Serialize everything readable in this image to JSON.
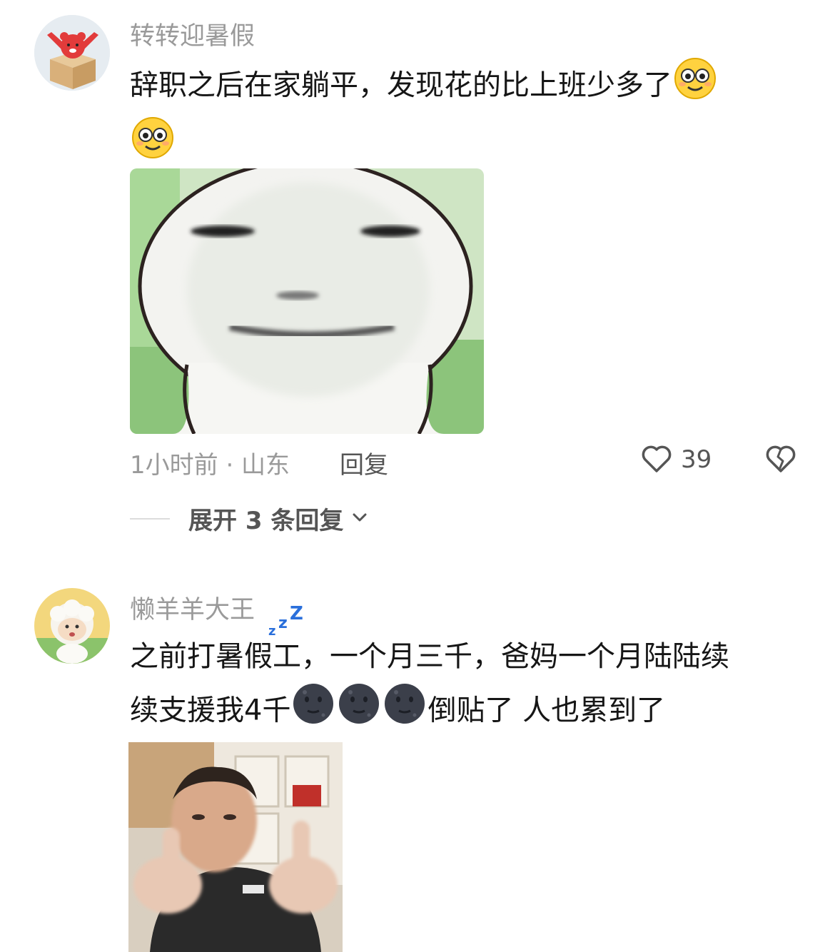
{
  "comments": [
    {
      "username": "转转迎暑假",
      "text_line1": "辞职之后在家躺平，发现花的比上班少多了",
      "emoji_name": "flushed-face",
      "time_location": "1小时前 · 山东",
      "reply_label": "回复",
      "like_count": "39",
      "expand_label": "展开 3 条回复",
      "image_alt": "meme-face-sticker"
    },
    {
      "username": "懒羊羊大王",
      "badge": "zzz-sleeping",
      "text_line1": "之前打暑假工，一个月三千，爸妈一个月陆陆续",
      "text_line2a": "续支援我4千",
      "text_line2b": "倒贴了 人也累到了",
      "emoji_name": "new-moon-face",
      "image_alt": "thumbs-up-man-gif"
    }
  ],
  "colors": {
    "text": "#161616",
    "muted": "#9a9a9a",
    "secondary": "#555555",
    "zzz": "#2a6fdb"
  }
}
